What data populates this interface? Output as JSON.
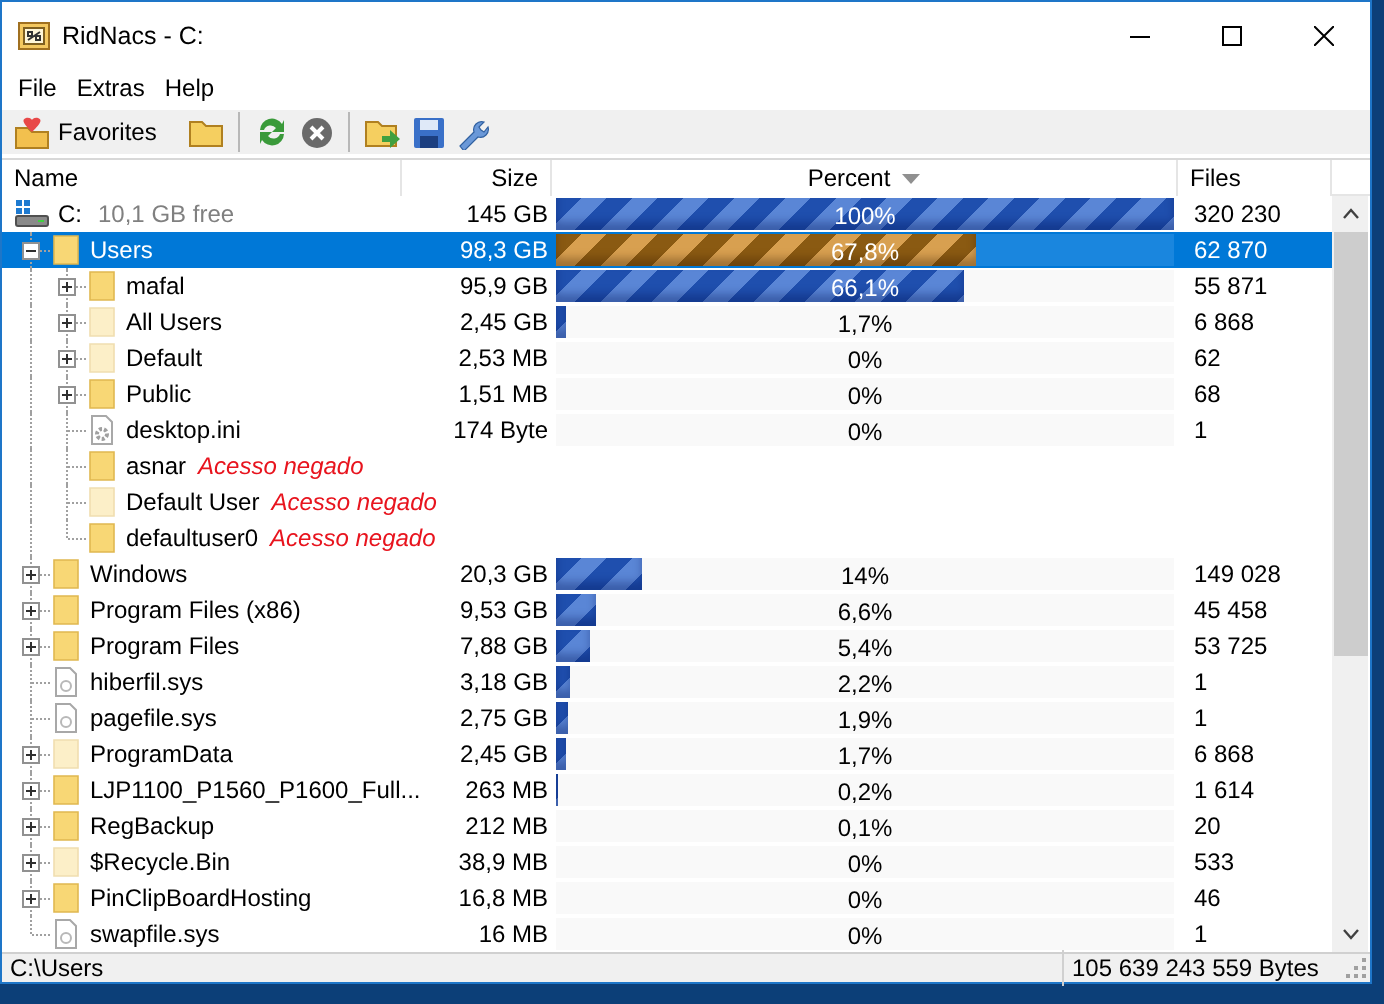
{
  "window": {
    "title": "RidNacs - C:"
  },
  "menu": [
    "File",
    "Extras",
    "Help"
  ],
  "toolbar": {
    "favorites_label": "Favorites"
  },
  "columns": [
    {
      "label": "Name",
      "sorted": false
    },
    {
      "label": "Size",
      "sorted": false
    },
    {
      "label": "Percent",
      "sorted": true
    },
    {
      "label": "Files",
      "sorted": false
    }
  ],
  "tree": {
    "name": "C:",
    "free": "10,1 GB free",
    "size": "145 GB",
    "percent": "100%",
    "level": 1,
    "files": "320 230",
    "selected": false,
    "kind": "drive",
    "children": [
      {
        "name": "Users",
        "size": "98,3 GB",
        "percent": "67,8%",
        "level": 0.678,
        "files": "62 870",
        "selected": true,
        "kind": "folder",
        "expanded": true,
        "children": [
          {
            "name": "mafal",
            "size": "95,9 GB",
            "percent": "66,1%",
            "level": 0.661,
            "files": "55 871",
            "selected": false,
            "kind": "folder",
            "expanded": false
          },
          {
            "name": "All Users",
            "size": "2,45 GB",
            "percent": "1,7%",
            "level": 0.017,
            "files": "6 868",
            "selected": false,
            "kind": "hidden-folder",
            "expanded": false
          },
          {
            "name": "Default",
            "size": "2,53 MB",
            "percent": "0%",
            "level": 0,
            "files": "62",
            "selected": false,
            "kind": "hidden-folder",
            "expanded": false
          },
          {
            "name": "Public",
            "size": "1,51 MB",
            "percent": "0%",
            "level": 0,
            "files": "68",
            "selected": false,
            "kind": "folder",
            "expanded": false
          },
          {
            "name": "desktop.ini",
            "size": "174 Byte",
            "percent": "0%",
            "level": 0,
            "files": "1",
            "selected": false,
            "kind": "settings-file"
          },
          {
            "name": "asnar",
            "note": "Acesso negado",
            "selected": false,
            "kind": "folder"
          },
          {
            "name": "Default User",
            "note": "Acesso negado",
            "selected": false,
            "kind": "hidden-folder"
          },
          {
            "name": "defaultuser0",
            "note": "Acesso negado",
            "selected": false,
            "kind": "folder"
          }
        ]
      },
      {
        "name": "Windows",
        "size": "20,3 GB",
        "percent": "14%",
        "level": 0.14,
        "files": "149 028",
        "selected": false,
        "kind": "folder",
        "expanded": false
      },
      {
        "name": "Program Files (x86)",
        "size": "9,53 GB",
        "percent": "6,6%",
        "level": 0.066,
        "files": "45 458",
        "selected": false,
        "kind": "folder",
        "expanded": false
      },
      {
        "name": "Program Files",
        "size": "7,88 GB",
        "percent": "5,4%",
        "level": 0.054,
        "files": "53 725",
        "selected": false,
        "kind": "folder",
        "expanded": false
      },
      {
        "name": "hiberfil.sys",
        "size": "3,18 GB",
        "percent": "2,2%",
        "level": 0.022,
        "files": "1",
        "selected": false,
        "kind": "file"
      },
      {
        "name": "pagefile.sys",
        "size": "2,75 GB",
        "percent": "1,9%",
        "level": 0.019,
        "files": "1",
        "selected": false,
        "kind": "file"
      },
      {
        "name": "ProgramData",
        "size": "2,45 GB",
        "percent": "1,7%",
        "level": 0.017,
        "files": "6 868",
        "selected": false,
        "kind": "hidden-folder",
        "expanded": false
      },
      {
        "name": "LJP1100_P1560_P1600_Full...",
        "size": "263 MB",
        "percent": "0,2%",
        "level": 0.002,
        "files": "1 614",
        "selected": false,
        "kind": "folder",
        "expanded": false
      },
      {
        "name": "RegBackup",
        "size": "212 MB",
        "percent": "0,1%",
        "level": 0.001,
        "files": "20",
        "selected": false,
        "kind": "folder",
        "expanded": false
      },
      {
        "name": "$Recycle.Bin",
        "size": "38,9 MB",
        "percent": "0%",
        "level": 0,
        "files": "533",
        "selected": false,
        "kind": "hidden-folder",
        "expanded": false
      },
      {
        "name": "PinClipBoardHosting",
        "size": "16,8 MB",
        "percent": "0%",
        "level": 0,
        "files": "46",
        "selected": false,
        "kind": "folder",
        "expanded": false
      },
      {
        "name": "swapfile.sys",
        "size": "16 MB",
        "percent": "0%",
        "level": 0,
        "files": "1",
        "selected": false,
        "kind": "file"
      }
    ]
  },
  "status_bar": {
    "path": "C:\\Users",
    "total": "105 639 243 559 Bytes"
  }
}
